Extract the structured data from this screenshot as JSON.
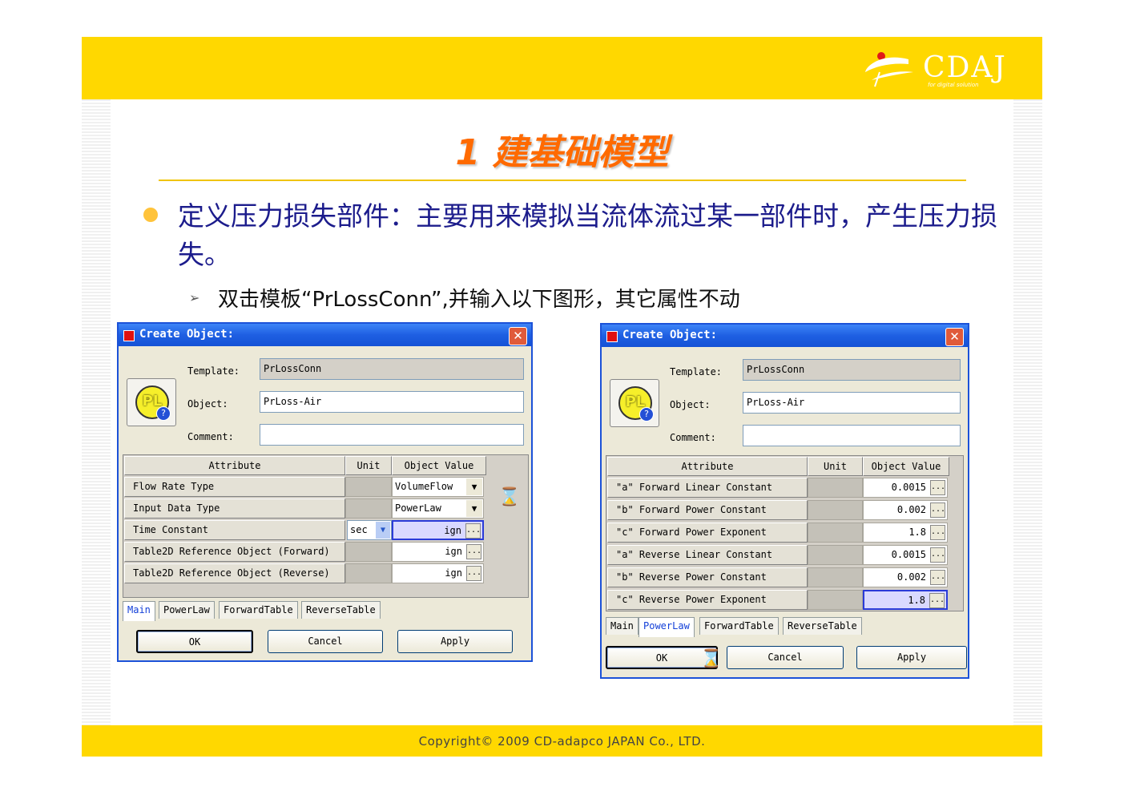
{
  "brand": {
    "logo_text": "CDAJ",
    "logo_tagline": "for digital solution"
  },
  "slide_title": "1 建基础模型",
  "bullet_text": "定义压力损失部件：主要用来模拟当流体流过某一部件时，产生压力损失。",
  "sub_bullet_text": "双击模板“PrLossConn”,并输入以下图形，其它属性不动",
  "footer_text": "Copyright© 2009 CD-adapco JAPAN Co., LTD.",
  "dialog_left": {
    "title": "Create Object:",
    "close_label": "✕",
    "icon_text": "PL",
    "template_label": "Template:",
    "template_value": "PrLossConn",
    "object_label": "Object:",
    "object_value": "PrLoss-Air",
    "comment_label": "Comment:",
    "comment_value": "",
    "col_attribute": "Attribute",
    "col_unit": "Unit",
    "col_value": "Object Value",
    "rows": [
      {
        "attribute": "Flow Rate Type",
        "unit": "",
        "value": "VolumeFlow"
      },
      {
        "attribute": "Input Data Type",
        "unit": "",
        "value": "PowerLaw"
      },
      {
        "attribute": "Time Constant",
        "unit": "sec",
        "value": "ign"
      },
      {
        "attribute": "Table2D Reference Object (Forward)",
        "unit": "",
        "value": "ign"
      },
      {
        "attribute": "Table2D Reference Object (Reverse)",
        "unit": "",
        "value": "ign"
      }
    ],
    "tabs": [
      "Main",
      "PowerLaw",
      "ForwardTable",
      "ReverseTable"
    ],
    "ok_label": "OK",
    "cancel_label": "Cancel",
    "apply_label": "Apply"
  },
  "dialog_right": {
    "title": "Create Object:",
    "close_label": "✕",
    "icon_text": "PL",
    "template_label": "Template:",
    "template_value": "PrLossConn",
    "object_label": "Object:",
    "object_value": "PrLoss-Air",
    "comment_label": "Comment:",
    "comment_value": "",
    "col_attribute": "Attribute",
    "col_unit": "Unit",
    "col_value": "Object Value",
    "rows": [
      {
        "attribute": "\"a\" Forward Linear Constant",
        "unit": "",
        "value": "0.0015"
      },
      {
        "attribute": "\"b\" Forward Power Constant",
        "unit": "",
        "value": "0.002"
      },
      {
        "attribute": "\"c\" Forward Power Exponent",
        "unit": "",
        "value": "1.8"
      },
      {
        "attribute": "\"a\" Reverse Linear Constant",
        "unit": "",
        "value": "0.0015"
      },
      {
        "attribute": "\"b\" Reverse Power Constant",
        "unit": "",
        "value": "0.002"
      },
      {
        "attribute": "\"c\" Reverse Power Exponent",
        "unit": "",
        "value": "1.8"
      }
    ],
    "tabs": [
      "Main",
      "PowerLaw",
      "ForwardTable",
      "ReverseTable"
    ],
    "ok_label": "OK",
    "cancel_label": "Cancel",
    "apply_label": "Apply"
  },
  "icons": {
    "ellipsis": "...",
    "dropdown": "▼",
    "hourglass": "⌛"
  },
  "colors": {
    "brand_yellow": "#ffd800",
    "title_orange": "#ff6a00",
    "text_navy": "#1c1c8c"
  }
}
